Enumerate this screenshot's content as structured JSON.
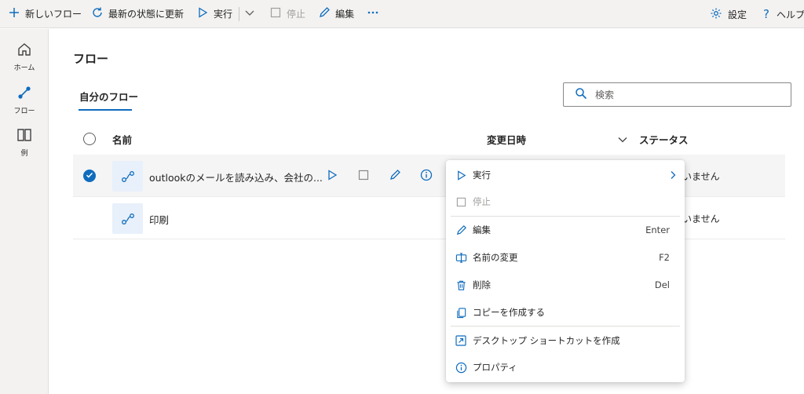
{
  "toolbar": {
    "new_flow": "新しいフロー",
    "refresh": "最新の状態に更新",
    "run": "実行",
    "stop": "停止",
    "edit": "編集",
    "settings": "設定",
    "help": "ヘルプ"
  },
  "leftnav": {
    "home": "ホーム",
    "flows": "フロー",
    "examples": "例"
  },
  "page": {
    "title": "フロー",
    "tab": "自分のフロー",
    "search_placeholder": "検索"
  },
  "table": {
    "columns": {
      "name": "名前",
      "modified": "変更日時",
      "status": "ステータス"
    },
    "rows": [
      {
        "name": "outlookのメールを読み込み、会社の...",
        "status": "いません",
        "selected": true
      },
      {
        "name": "印刷",
        "status": "いません",
        "selected": false
      }
    ]
  },
  "context_menu": {
    "items": [
      {
        "label": "実行",
        "icon": "play-icon",
        "key": ""
      },
      {
        "label": "停止",
        "icon": "stop-icon",
        "key": ""
      },
      {
        "label": "編集",
        "icon": "pencil-icon",
        "key": "Enter"
      },
      {
        "label": "名前の変更",
        "icon": "rename-icon",
        "key": "F2"
      },
      {
        "label": "削除",
        "icon": "trash-icon",
        "key": "Del"
      },
      {
        "label": "コピーを作成する",
        "icon": "copy-icon",
        "key": ""
      },
      {
        "label": "デスクトップ ショートカットを作成",
        "icon": "shortcut-icon",
        "key": ""
      },
      {
        "label": "プロパティ",
        "icon": "info-icon",
        "key": ""
      }
    ]
  },
  "colors": {
    "accent": "#0f6cbd",
    "toolbar_bg": "#f3f2f1",
    "selected_row": "#f5f5f5"
  }
}
